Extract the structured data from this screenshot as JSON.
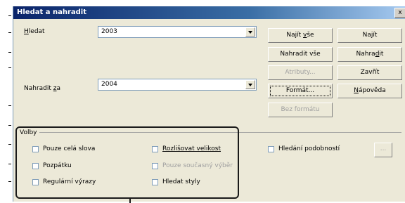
{
  "dialog": {
    "title": "Hledat a nahradit",
    "close_label": "x"
  },
  "search": {
    "label_prefix": "H",
    "label_rest": "ledat",
    "value": "2003"
  },
  "replace": {
    "label_prefix": "Nahradit ",
    "label_u": "z",
    "label_rest": "a",
    "value": "2004"
  },
  "buttons": {
    "find_all_a": "Najít ",
    "find_all_u": "v",
    "find_all_b": "še",
    "find": "Najít",
    "replace_all": "Nahradit vše",
    "replace_a": "Nahra",
    "replace_u": "d",
    "replace_b": "it",
    "attributes": "Atributy...",
    "close": "Zavřít",
    "format": "Formát...",
    "help_u": "N",
    "help_rest": "ápověda",
    "no_format": "Bez formátu",
    "ellipsis": "..."
  },
  "options": {
    "group_label": "Volby",
    "whole_words": "Pouze celá slova",
    "match_case": "Rozlišovat velikost",
    "similarity": "Hledání podobností",
    "backwards": "Pozpátku",
    "current_selection": "Pouze současný výběr",
    "regex": "Regulární výrazy",
    "styles": "Hledat styly"
  }
}
